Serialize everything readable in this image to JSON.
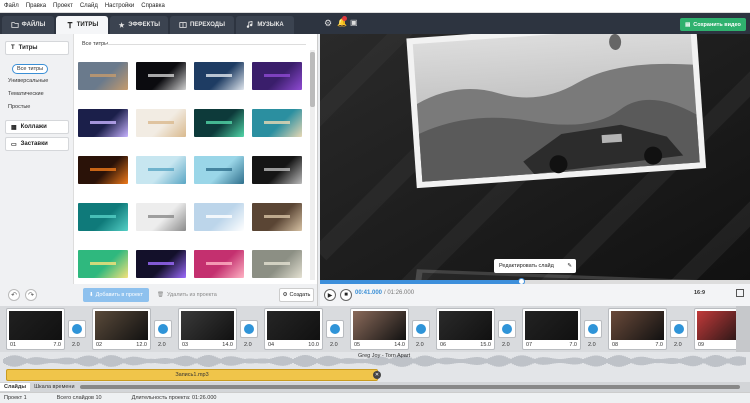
{
  "menu": [
    "Файл",
    "Правка",
    "Проект",
    "Слайд",
    "Настройки",
    "Справка"
  ],
  "tabs": [
    {
      "label": "ФАЙЛЫ",
      "icon": "folder-icon"
    },
    {
      "label": "ТИТРЫ",
      "icon": "text-icon"
    },
    {
      "label": "ЭФФЕКТЫ",
      "icon": "effects-icon"
    },
    {
      "label": "ПЕРЕХОДЫ",
      "icon": "transitions-icon"
    },
    {
      "label": "МУЗЫКА",
      "icon": "music-icon"
    }
  ],
  "categories": {
    "titles": "Титры",
    "sub": [
      "Все титры",
      "Универсальные",
      "Тематические",
      "Простые"
    ],
    "collages": "Коллажи",
    "intros": "Заставки"
  },
  "grid_title": "Все титры",
  "thumbnails": [
    {
      "color": "#6a7a8c",
      "accent": "#c59b6d"
    },
    {
      "color": "#0b0b0f",
      "accent": "#d0d0d0"
    },
    {
      "color": "#1e3c63",
      "accent": "#e0e6ee"
    },
    {
      "color": "#3a1e6b",
      "accent": "#8f4ad3"
    },
    {
      "color": "#1b1f4a",
      "accent": "#c7b3ff"
    },
    {
      "color": "#f2ece3",
      "accent": "#d9b98d"
    },
    {
      "color": "#0d3a3a",
      "accent": "#52d6a8"
    },
    {
      "color": "#2b8fa0",
      "accent": "#e8d8b4"
    },
    {
      "color": "#2a1208",
      "accent": "#f07a1a"
    },
    {
      "color": "#c7e6f0",
      "accent": "#5aa6c4"
    },
    {
      "color": "#9ad6e8",
      "accent": "#2f6f8c"
    },
    {
      "color": "#151515",
      "accent": "#bbbbbb"
    },
    {
      "color": "#0f7a7a",
      "accent": "#55d0c6"
    },
    {
      "color": "#ededed",
      "accent": "#8a8a8a"
    },
    {
      "color": "#bcd5ea",
      "accent": "#ffffff"
    },
    {
      "color": "#5a4534",
      "accent": "#d7c2a4"
    },
    {
      "color": "#2fb87e",
      "accent": "#f6e27a"
    },
    {
      "color": "#13102a",
      "accent": "#9d6bff"
    },
    {
      "color": "#c4306f",
      "accent": "#ffb3c4"
    },
    {
      "color": "#8c8f84",
      "accent": "#e4e1d2"
    }
  ],
  "left_bottom": {
    "add": "Добавить в проект",
    "delete": "Удалить из проекта",
    "create": "Создать"
  },
  "save": "Сохранить видео",
  "preview": {
    "edit_label": "Редактировать слайд"
  },
  "playback": {
    "current": "00:41.000",
    "total": "/ 01:26.000",
    "progress": 0.47,
    "ratio": "16:9"
  },
  "slides": [
    {
      "num": "01",
      "dur": "7.0",
      "color": "#202020"
    },
    {
      "num": "02",
      "dur": "12.0",
      "color": "#5a4a3a"
    },
    {
      "num": "03",
      "dur": "14.0",
      "color": "#3a3a3a"
    },
    {
      "num": "04",
      "dur": "10.0",
      "color": "#252525"
    },
    {
      "num": "05",
      "dur": "14.0",
      "color": "#8a6a5a"
    },
    {
      "num": "06",
      "dur": "15.0",
      "color": "#2a2a2a"
    },
    {
      "num": "07",
      "dur": "7.0",
      "color": "#222222"
    },
    {
      "num": "08",
      "dur": "7.0",
      "color": "#6a4a3a"
    },
    {
      "num": "09",
      "dur": "",
      "color": "#c23a3a"
    }
  ],
  "transitions": [
    "2.0",
    "2.0",
    "2.0",
    "2.0",
    "2.0",
    "2.0",
    "2.0",
    "2.0"
  ],
  "audio_label": "Greg Joy - Torn Apart",
  "voice_label": "Запись1.mp3",
  "bottom_tabs": [
    "Слайды",
    "Шкала времени"
  ],
  "status": [
    "Проект 1",
    "Всего слайдов 10",
    "Длительность проекта: 01:26.000"
  ]
}
